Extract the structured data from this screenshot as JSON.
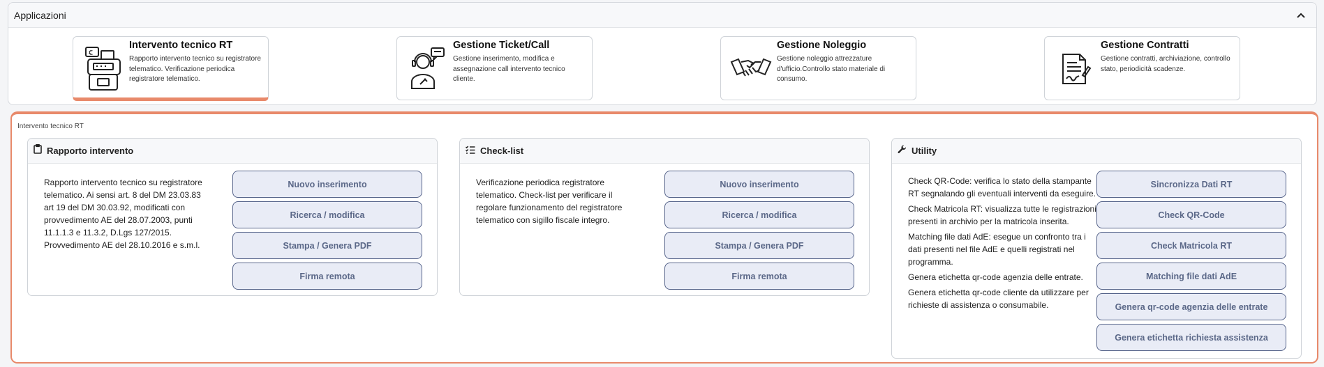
{
  "apps": {
    "title": "Applicazioni",
    "cards": [
      {
        "title": "Intervento tecnico RT",
        "desc": "Rapporto intervento tecnico su registratore telematico. Verificazione periodica registratore telematico.",
        "icon": "cash-register-icon"
      },
      {
        "title": "Gestione Ticket/Call",
        "desc": "Gestione inserimento, modifica e assegnazione call intervento tecnico cliente.",
        "icon": "technician-icon"
      },
      {
        "title": "Gestione Noleggio",
        "desc": "Gestione noleggio attrezzature d'ufficio.Controllo stato materiale di consumo.",
        "icon": "handshake-icon"
      },
      {
        "title": "Gestione Contratti",
        "desc": "Gestione contratti, archiviazione, controllo stato, periodicità scadenze.",
        "icon": "contract-icon"
      }
    ]
  },
  "section": {
    "label": "Intervento tecnico RT",
    "rapporto": {
      "title": "Rapporto intervento",
      "desc": "Rapporto intervento tecnico su registratore telematico. Ai sensi art. 8 del DM 23.03.83 art 19 del DM 30.03.92, modificati con provvedimento AE del 28.07.2003, punti 11.1.1.3 e 11.3.2, D.Lgs 127/2015. Provvedimento AE del 28.10.2016 e s.m.l.",
      "buttons": [
        "Nuovo inserimento",
        "Ricerca / modifica",
        "Stampa / Genera PDF",
        "Firma remota"
      ]
    },
    "checklist": {
      "title": "Check-list",
      "desc": "Verificazione periodica registratore telematico. Check-list per verificare il regolare funzionamento del registratore telematico con sigillo fiscale integro.",
      "buttons": [
        "Nuovo inserimento",
        "Ricerca / modifica",
        "Stampa / Genera PDF",
        "Firma remota"
      ]
    },
    "utility": {
      "title": "Utility",
      "items": [
        "Check QR-Code: verifica lo stato della stampante RT segnalando gli eventuali interventi da eseguire.",
        "Check Matricola RT: visualizza tutte le registrazioni presenti in archivio per la matricola inserita.",
        "Matching file dati AdE: esegue un confronto tra i dati presenti nel file AdE e quelli registrati nel programma.",
        "Genera etichetta qr-code agenzia delle entrate.",
        "Genera etichetta qr-code cliente da utilizzare per richieste di assistenza o consumabile."
      ],
      "buttons": [
        "Sincronizza Dati RT",
        "Check QR-Code",
        "Check Matricola RT",
        "Matching file dati AdE",
        "Genera qr-code agenzia delle entrate",
        "Genera etichetta richiesta assistenza"
      ]
    }
  },
  "colors": {
    "accent": "#e8896a",
    "button_bg": "#e9ecf6",
    "button_border": "#56648a",
    "button_text": "#5b6888"
  }
}
